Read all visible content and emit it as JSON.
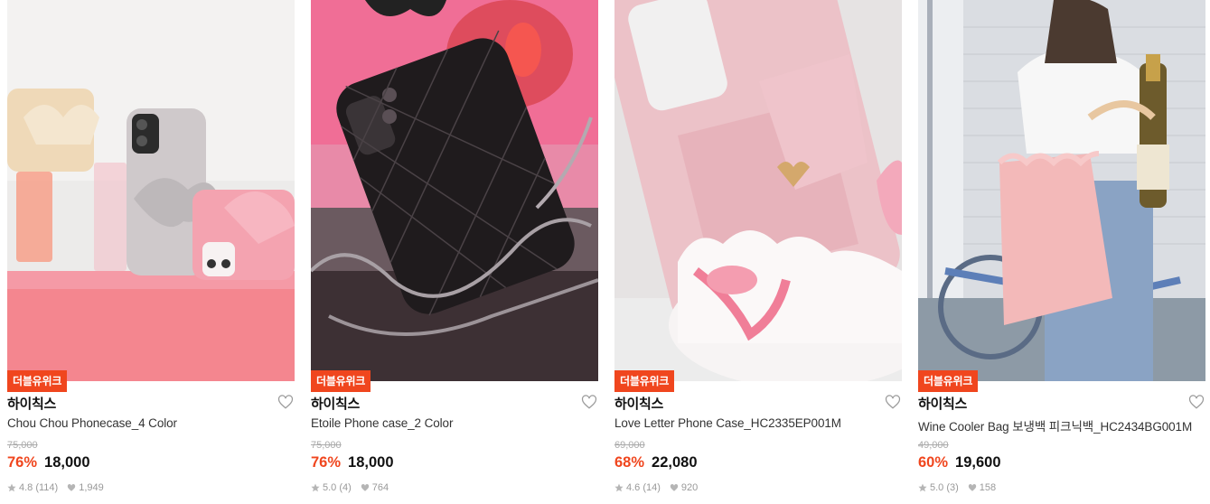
{
  "colors": {
    "accent": "#f0461e",
    "meta_text": "#999999",
    "original_price": "#aaaaaa"
  },
  "products": [
    {
      "badge": "더블유위크",
      "brand": "하이칙스",
      "name": "Chou Chou Phonecase_4 Color",
      "original_price": "75,000",
      "discount": "76%",
      "price": "18,000",
      "rating": "4.8 (114)",
      "likes": "1,949",
      "icon": "heart-outline-icon"
    },
    {
      "badge": "더블유위크",
      "brand": "하이칙스",
      "name": "Etoile Phone case_2 Color",
      "original_price": "75,000",
      "discount": "76%",
      "price": "18,000",
      "rating": "5.0 (4)",
      "likes": "764",
      "icon": "heart-outline-icon"
    },
    {
      "badge": "더블유위크",
      "brand": "하이칙스",
      "name": "Love Letter Phone Case_HC2335EP001M",
      "original_price": "69,000",
      "discount": "68%",
      "price": "22,080",
      "rating": "4.6 (14)",
      "likes": "920",
      "icon": "heart-outline-icon"
    },
    {
      "badge": "더블유위크",
      "brand": "하이칙스",
      "name": "Wine Cooler Bag 보냉백 피크닉백_HC2434BG001M",
      "original_price": "49,000",
      "discount": "60%",
      "price": "19,600",
      "rating": "5.0 (3)",
      "likes": "158",
      "icon": "heart-outline-icon"
    }
  ]
}
